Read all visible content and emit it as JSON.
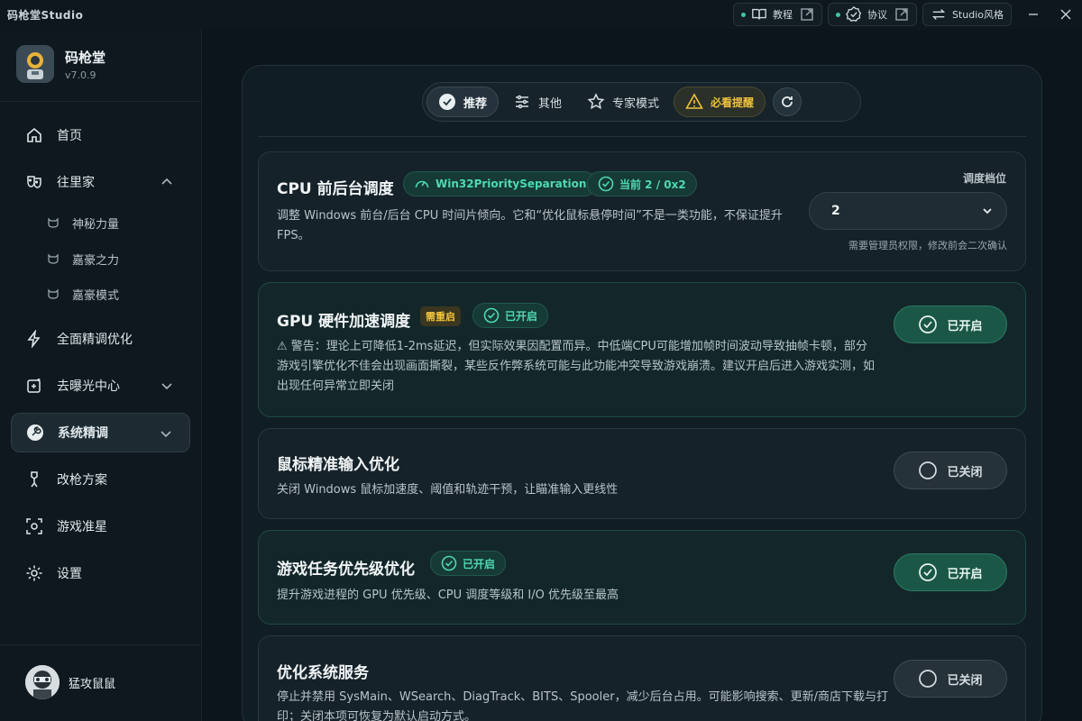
{
  "titlebar": {
    "app_title": "码枪堂Studio",
    "tutorial_label": "教程",
    "protocol_label": "协议",
    "studio_style_label": "Studio风格"
  },
  "brand": {
    "name": "码枪堂",
    "version": "v7.0.9"
  },
  "sidebar": {
    "items": [
      {
        "label": "首页",
        "icon": "home-icon"
      },
      {
        "label": "往里家",
        "icon": "mask-icon",
        "expanded": true
      },
      {
        "label": "全面精调优化",
        "icon": "lightning-icon"
      },
      {
        "label": "去曝光中心",
        "icon": "sparkle-frame-icon"
      },
      {
        "label": "系统精调",
        "icon": "wrench-icon",
        "active": true
      },
      {
        "label": "改枪方案",
        "icon": "medal-icon"
      },
      {
        "label": "游戏准星",
        "icon": "crosshair-icon"
      },
      {
        "label": "设置",
        "icon": "gear-icon"
      }
    ],
    "subitems": [
      {
        "label": "神秘力量"
      },
      {
        "label": "嘉豪之力"
      },
      {
        "label": "嘉豪模式"
      }
    ],
    "user_name": "猛攻鼠鼠"
  },
  "tabs": [
    {
      "label": "推荐",
      "active": true
    },
    {
      "label": "其他"
    },
    {
      "label": "专家模式"
    },
    {
      "label": "必看提醒",
      "warning": true
    }
  ],
  "cards": {
    "cpu": {
      "title": "CPU 前后台调度",
      "badge_key": "Win32PrioritySeparation",
      "badge_current": "当前 2 / 0x2",
      "desc": "调整 Windows 前台/后台 CPU 时间片倾向。它和“优化鼠标悬停时间”不是一类功能，不保证提升 FPS。",
      "select_label": "调度档位",
      "select_value": "2",
      "select_hint": "需要管理员权限，修改前会二次确认"
    },
    "gpu": {
      "title": "GPU 硬件加速调度",
      "badge_restart": "需重启",
      "badge_status": "已开启",
      "desc": "⚠ 警告：理论上可降低1-2ms延迟，但实际效果因配置而异。中低端CPU可能增加帧时间波动导致抽帧卡顿，部分游戏引擎优化不佳会出现画面撕裂，某些反作弊系统可能与此功能冲突导致游戏崩溃。建议开启后进入游戏实测，如出现任何异常立即关闭",
      "toggle": "已开启"
    },
    "mouse": {
      "title": "鼠标精准输入优化",
      "desc": "关闭 Windows 鼠标加速度、阈值和轨迹干预，让瞄准输入更线性",
      "toggle": "已关闭"
    },
    "game": {
      "title": "游戏任务优先级优化",
      "badge_status": "已开启",
      "desc": "提升游戏进程的 GPU 优先级、CPU 调度等级和 I/O 优先级至最高",
      "toggle": "已开启"
    },
    "service": {
      "title": "优化系统服务",
      "desc": "停止并禁用 SysMain、WSearch、DiagTrack、BITS、Spooler，减少后台占用。可能影响搜索、更新/商店下载与打印；关闭本项可恢复为默认启动方式。",
      "toggle": "已关闭"
    }
  },
  "colors": {
    "accent": "#3ec7a0",
    "warning": "#f0c23c",
    "background": "#0c151b"
  }
}
